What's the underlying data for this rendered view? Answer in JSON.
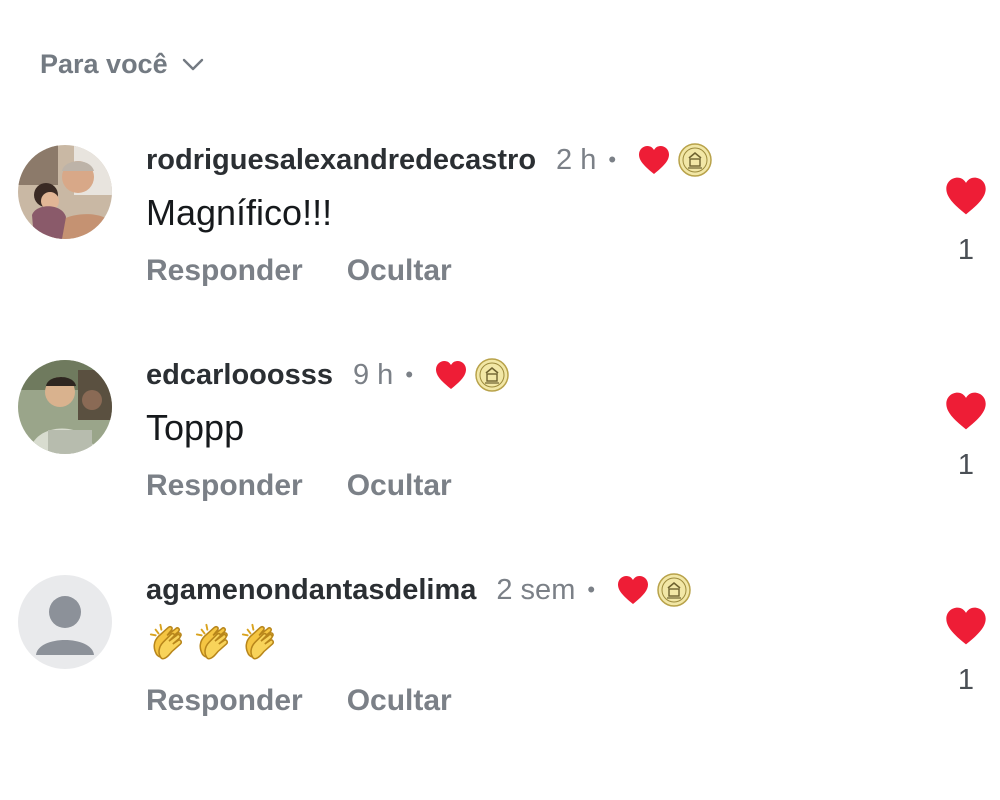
{
  "sort": {
    "label": "Para você",
    "chevron_icon": "chevron-down-icon"
  },
  "colors": {
    "heart": "#ee1d36",
    "muted": "#7b8087",
    "text": "#16191c"
  },
  "comments": [
    {
      "username": "rodriguesalexandredecastro",
      "time": "2 h",
      "separator": "•",
      "text": "Magnífico!!!",
      "creator_heart_icon": "heart-icon",
      "badge_icon": "creator-badge-icon",
      "reply_label": "Responder",
      "hide_label": "Ocultar",
      "like_count": "1"
    },
    {
      "username": "edcarlooosss",
      "time": "9 h",
      "separator": "•",
      "text": "Toppp",
      "creator_heart_icon": "heart-icon",
      "badge_icon": "creator-badge-icon",
      "reply_label": "Responder",
      "hide_label": "Ocultar",
      "like_count": "1"
    },
    {
      "username": "agamenondantasdelima",
      "time": "2 sem",
      "separator": "•",
      "text": "👏👏👏",
      "creator_heart_icon": "heart-icon",
      "badge_icon": "creator-badge-icon",
      "reply_label": "Responder",
      "hide_label": "Ocultar",
      "like_count": "1"
    }
  ]
}
